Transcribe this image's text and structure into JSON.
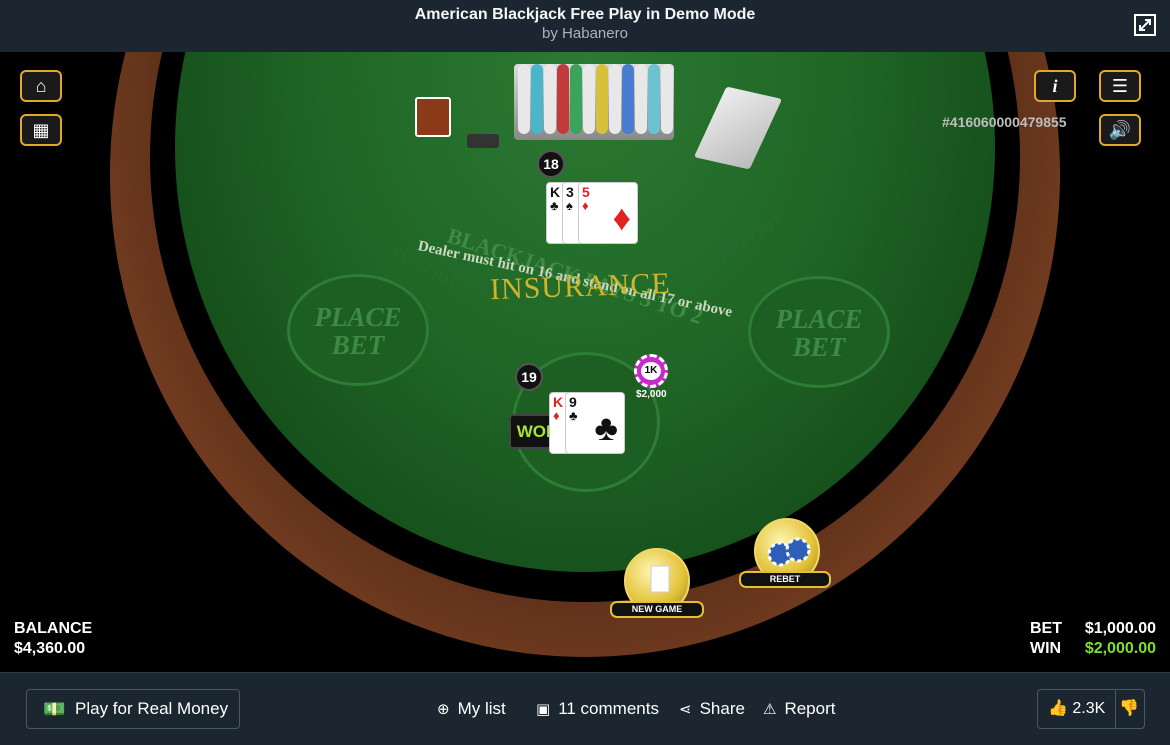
{
  "header": {
    "title": "American Blackjack Free Play in Demo Mode",
    "subtitle": "by Habanero"
  },
  "table": {
    "dealer_rule": "Dealer must hit on 16 and stand on all 17 or above",
    "blackjack_pays": "BLACKJACK PAYS 3 TO 2",
    "insurance": "INSURANCE",
    "pays_2_to_1": "PAYS 2 TO 1",
    "place_bet_line1": "PLACE",
    "place_bet_line2": "BET"
  },
  "dealer": {
    "score": "18",
    "cards": [
      {
        "rank": "K",
        "suit": "♣",
        "color": "#111111"
      },
      {
        "rank": "3",
        "suit": "♠",
        "color": "#111111"
      },
      {
        "rank": "5",
        "suit": "♦",
        "color": "#e02222"
      }
    ]
  },
  "player": {
    "score": "19",
    "result": "WON",
    "cards": [
      {
        "rank": "K",
        "suit": "♦",
        "color": "#e02222"
      },
      {
        "rank": "9",
        "suit": "♣",
        "color": "#111111"
      }
    ],
    "chip_label": "1K",
    "chip_amount": "$2,000"
  },
  "game_id": "#416060000479855",
  "controls": {
    "home_icon": "home-icon",
    "grid_icon": "grid-icon",
    "info_icon": "info-icon",
    "menu_icon": "menu-icon",
    "sound_icon": "speaker-icon",
    "new_game": "NEW GAME",
    "rebet": "REBET"
  },
  "stats": {
    "balance_label": "BALANCE",
    "balance_value": "$4,360.00",
    "bet_label": "BET",
    "bet_value": "$1,000.00",
    "win_label": "WIN",
    "win_value": "$2,000.00"
  },
  "footer": {
    "play_real": "Play for Real Money",
    "my_list": "My list",
    "comments": "11 comments",
    "share": "Share",
    "report": "Report",
    "likes": "2.3K"
  },
  "colors": {
    "felt": "#206626",
    "gold": "#e2c137",
    "win_green": "#7de02c",
    "chip": "#c42bc8"
  }
}
